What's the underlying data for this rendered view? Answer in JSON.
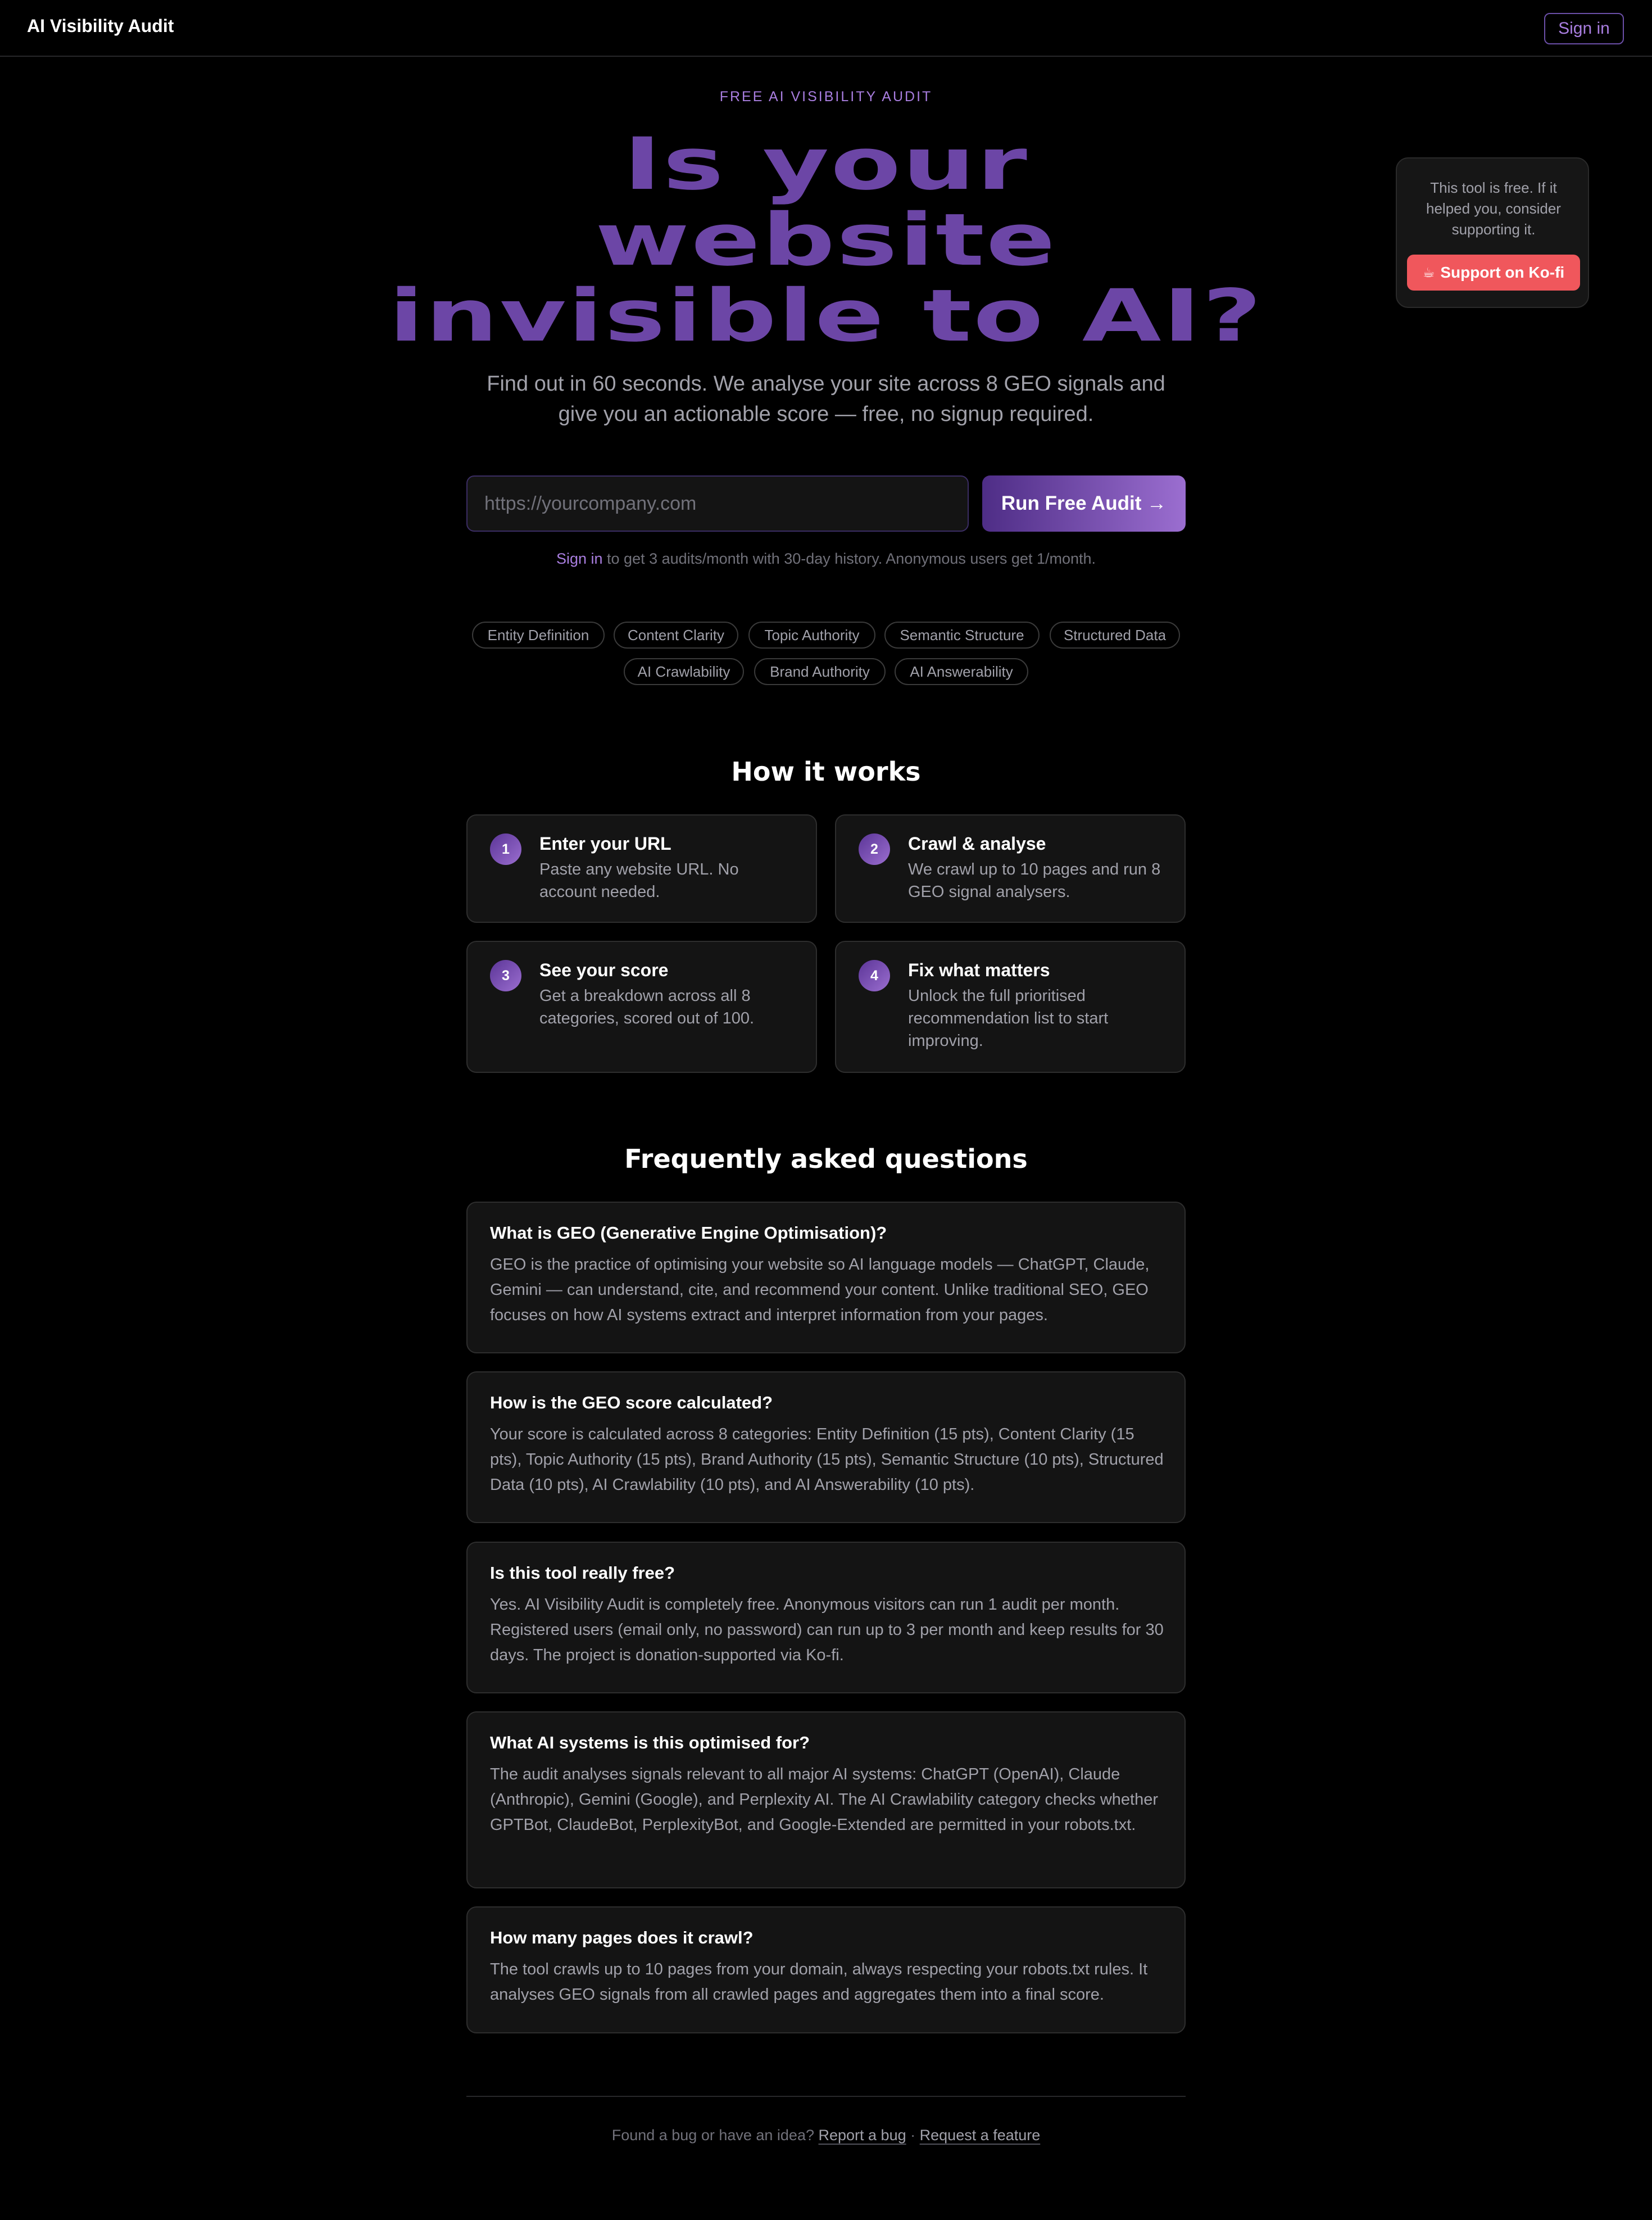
{
  "header": {
    "brand": "AI Visibility Audit",
    "signin_label": "Sign in"
  },
  "kofi": {
    "text": "This tool is free. If it helped you, consider supporting it.",
    "icon": "coffee-cup-icon",
    "button_label": "Support on Ko-fi",
    "button_color": "#f0575c"
  },
  "hero": {
    "eyebrow": "FREE AI VISIBILITY AUDIT",
    "title_line1": "Is your",
    "title_line2": "website",
    "title_line3": "invisible to AI?",
    "subtitle": "Find out in 60 seconds. We analyse your site across 8 GEO signals and give you an actionable score — free, no signup required.",
    "accent_color": "#6c46a6"
  },
  "audit_form": {
    "url_placeholder": "https://yourcompany.com",
    "url_value": "",
    "run_button_label": "Run Free Audit →",
    "signin_link": "Sign in",
    "signin_note": " to get 3 audits/month with 30-day history. Anonymous users get 1/month."
  },
  "signals": [
    "Entity Definition",
    "Content Clarity",
    "Topic Authority",
    "Semantic Structure",
    "Structured Data",
    "AI Crawlability",
    "Brand Authority",
    "AI Answerability"
  ],
  "how_it_works": {
    "title": "How it works",
    "steps": [
      {
        "num": "1",
        "title": "Enter your URL",
        "desc": "Paste any website URL. No account needed."
      },
      {
        "num": "2",
        "title": "Crawl & analyse",
        "desc": "We crawl up to 10 pages and run 8 GEO signal analysers."
      },
      {
        "num": "3",
        "title": "See your score",
        "desc": "Get a breakdown across all 8 categories, scored out of 100."
      },
      {
        "num": "4",
        "title": "Fix what matters",
        "desc": "Unlock the full prioritised recommendation list to start improving."
      }
    ]
  },
  "faq": {
    "title": "Frequently asked questions",
    "items": [
      {
        "q": "What is GEO (Generative Engine Optimisation)?",
        "a": "GEO is the practice of optimising your website so AI language models — ChatGPT, Claude, Gemini — can understand, cite, and recommend your content. Unlike traditional SEO, GEO focuses on how AI systems extract and interpret information from your pages."
      },
      {
        "q": "How is the GEO score calculated?",
        "a": "Your score is calculated across 8 categories: Entity Definition (15 pts), Content Clarity (15 pts), Topic Authority (15 pts), Brand Authority (15 pts), Semantic Structure (10 pts), Structured Data (10 pts), AI Crawlability (10 pts), and AI Answerability (10 pts)."
      },
      {
        "q": "Is this tool really free?",
        "a": "Yes. AI Visibility Audit is completely free. Anonymous visitors can run 1 audit per month. Registered users (email only, no password) can run up to 3 per month and keep results for 30 days. The project is donation-supported via Ko-fi."
      },
      {
        "q": "What AI systems is this optimised for?",
        "a": "The audit analyses signals relevant to all major AI systems: ChatGPT (OpenAI), Claude (Anthropic), Gemini (Google), and Perplexity AI. The AI Crawlability category checks whether GPTBot, ClaudeBot, PerplexityBot, and Google-Extended are permitted in your robots.txt."
      },
      {
        "q": "How many pages does it crawl?",
        "a": "The tool crawls up to 10 pages from your domain, always respecting your robots.txt rules. It analyses GEO signals from all crawled pages and aggregates them into a final score."
      }
    ]
  },
  "footer": {
    "prefix": "Found a bug or have an idea?",
    "report_bug": "Report a bug",
    "separator": "·",
    "request_feature": "Request a feature"
  }
}
